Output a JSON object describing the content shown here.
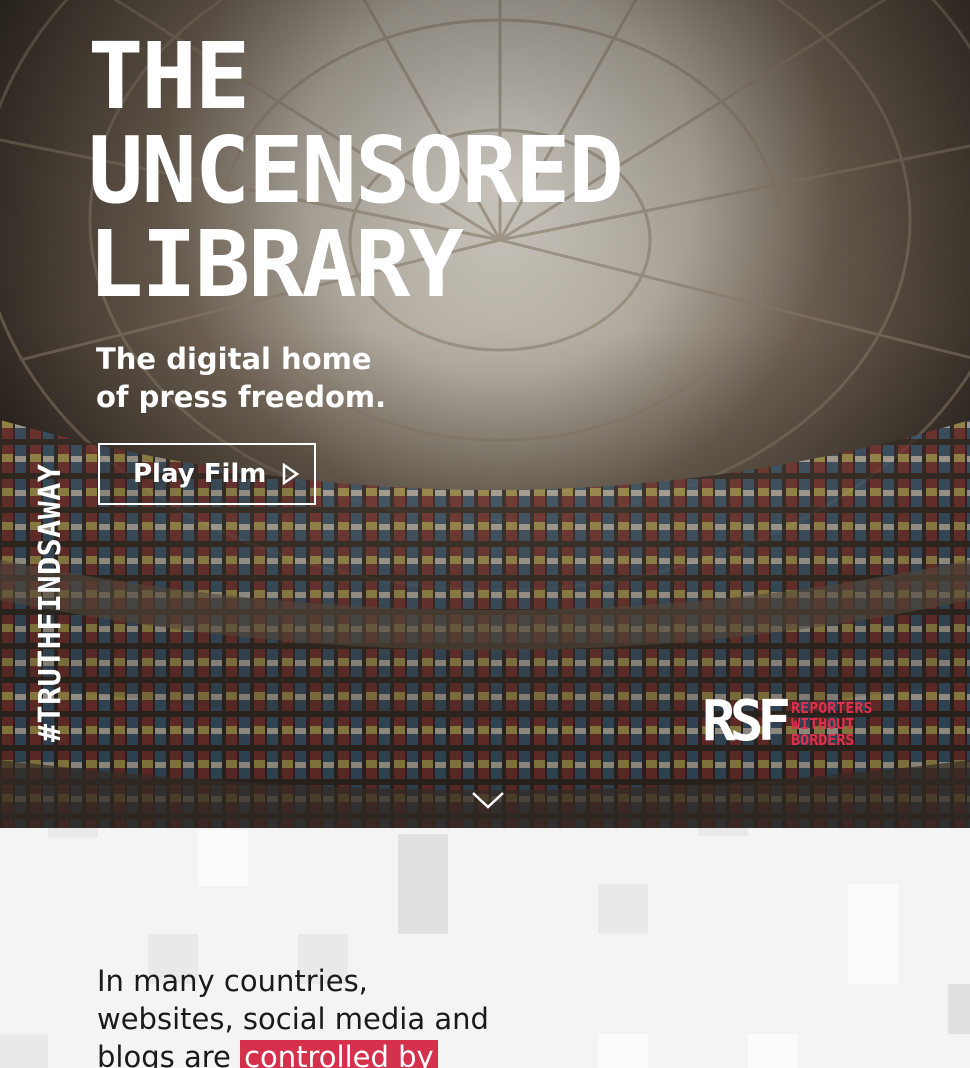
{
  "hero": {
    "title_lines": [
      "THE",
      "UNCENSORED",
      "LIBRARY"
    ],
    "subtitle_line1": "The digital home",
    "subtitle_line2": "of press freedom.",
    "play_button_label": "Play Film",
    "hashtag": "#TRUTHFINDSAWAY",
    "logo": {
      "mark": "RSF",
      "name_line1": "REPORTERS",
      "name_line2": "WITHOUT BORDERS"
    }
  },
  "intro": {
    "text_lines": [
      "In many countries,",
      "websites, social media and",
      "blogs are "
    ],
    "highlight": "controlled by"
  },
  "colors": {
    "accent": "#e0304e",
    "highlight_bg": "#d5304c",
    "text_dark": "#1a1a1a",
    "section_bg": "#f4f4f4"
  },
  "icons": {
    "play": "play-icon",
    "scroll": "chevron-down-icon"
  }
}
